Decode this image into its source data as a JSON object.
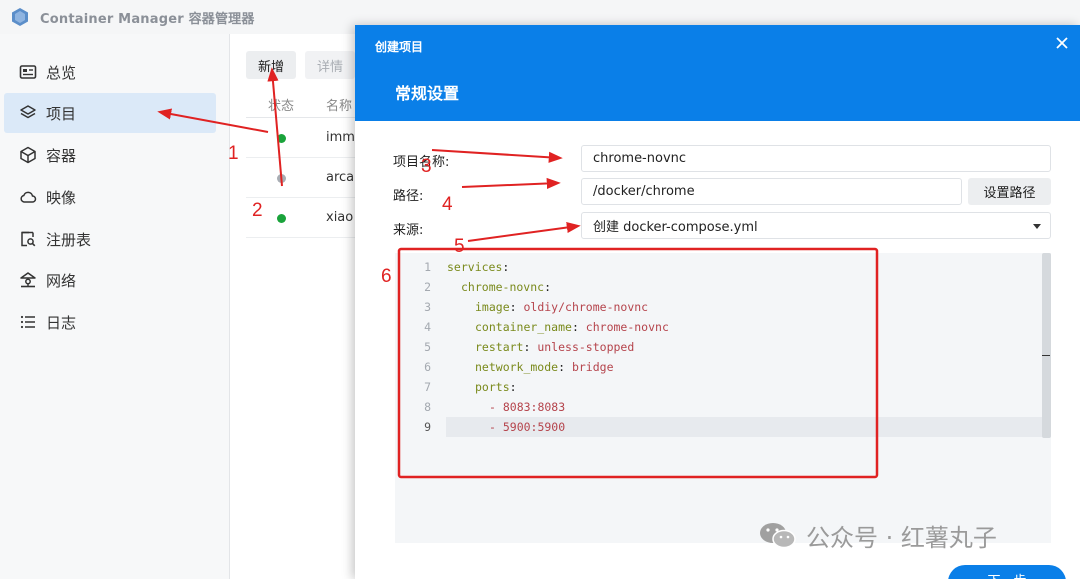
{
  "app": {
    "title": "Container Manager 容器管理器"
  },
  "sidebar": {
    "items": [
      {
        "label": "总览",
        "icon": "overview-icon"
      },
      {
        "label": "项目",
        "icon": "layers-icon",
        "active": true
      },
      {
        "label": "容器",
        "icon": "cube-icon"
      },
      {
        "label": "映像",
        "icon": "cloud-icon"
      },
      {
        "label": "注册表",
        "icon": "registry-icon"
      },
      {
        "label": "网络",
        "icon": "network-icon"
      },
      {
        "label": "日志",
        "icon": "log-list-icon"
      }
    ]
  },
  "projects": {
    "toolbar": {
      "add": "新增",
      "detail": "详情"
    },
    "columns": {
      "status": "状态",
      "name": "名称"
    },
    "rows": [
      {
        "name": "imm",
        "status": "running",
        "status_color": "#1aa33b"
      },
      {
        "name": "arca",
        "status": "stopped",
        "status_color": "#a8adb4"
      },
      {
        "name": "xiao",
        "status": "running",
        "status_color": "#1aa33b"
      }
    ]
  },
  "modal": {
    "caption": "创建项目",
    "heading": "常规设置",
    "fields": {
      "name": {
        "label": "项目名称:",
        "value": "chrome-novnc"
      },
      "path": {
        "label": "路径:",
        "value": "/docker/chrome",
        "button": "设置路径"
      },
      "source": {
        "label": "来源:",
        "value": "创建 docker-compose.yml"
      }
    },
    "editor": {
      "lines": [
        {
          "n": "1",
          "key": "services",
          "value": "",
          "indent": ""
        },
        {
          "n": "2",
          "key": "chrome-novnc",
          "value": "",
          "indent": "  "
        },
        {
          "n": "3",
          "key": "image",
          "value": "oldiy/chrome-novnc",
          "indent": "    "
        },
        {
          "n": "4",
          "key": "container_name",
          "value": "chrome-novnc",
          "indent": "    "
        },
        {
          "n": "5",
          "key": "restart",
          "value": "unless-stopped",
          "indent": "    "
        },
        {
          "n": "6",
          "key": "network_mode",
          "value": "bridge",
          "indent": "    "
        },
        {
          "n": "7",
          "key": "ports",
          "value": "",
          "indent": "    "
        },
        {
          "n": "8",
          "key": "",
          "value": "- 8083:8083",
          "indent": "      "
        },
        {
          "n": "9",
          "key": "",
          "value": "- 5900:5900",
          "indent": "      "
        }
      ],
      "current_line": 9
    },
    "next_button": "下一步"
  },
  "annotations": {
    "numbers": [
      "1",
      "2",
      "3",
      "4",
      "5",
      "6"
    ],
    "color": "#e02222"
  },
  "watermark": "公众号 · 红薯丸子"
}
